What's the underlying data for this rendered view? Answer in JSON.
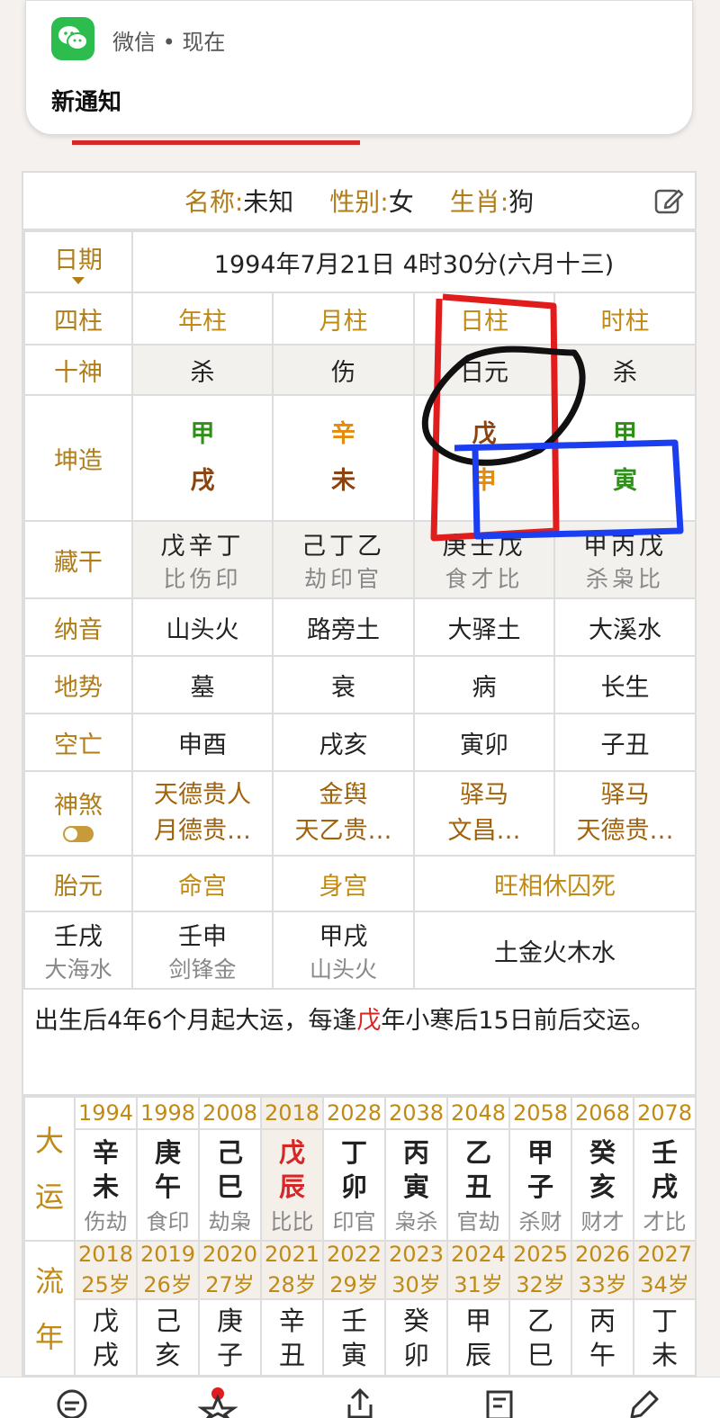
{
  "notification": {
    "app": "微信 • 现在",
    "message": "新通知"
  },
  "header": {
    "name_label": "名称:",
    "name_value": "未知",
    "gender_label": "性别:",
    "gender_value": "女",
    "zodiac_label": "生肖:",
    "zodiac_value": "狗"
  },
  "date": {
    "label": "日期",
    "value": "1994年7月21日 4时30分(六月十三)"
  },
  "pillars": {
    "label": "四柱",
    "headers": [
      "年柱",
      "月柱",
      "日柱",
      "时柱"
    ]
  },
  "shishen": {
    "label": "十神",
    "values": [
      "杀",
      "伤",
      "日元",
      "杀"
    ]
  },
  "kunzao": {
    "label": "坤造",
    "stems": [
      "甲",
      "辛",
      "戊",
      "甲"
    ],
    "branches": [
      "戌",
      "未",
      "申",
      "寅"
    ]
  },
  "canggan": {
    "label": "藏干",
    "stems": [
      "戊辛丁",
      "己丁乙",
      "庚壬戊",
      "甲丙戊"
    ],
    "gods": [
      "比伤印",
      "劫印官",
      "食才比",
      "杀枭比"
    ]
  },
  "nayin": {
    "label": "纳音",
    "values": [
      "山头火",
      "路旁土",
      "大驿土",
      "大溪水"
    ]
  },
  "dishi": {
    "label": "地势",
    "values": [
      "墓",
      "衰",
      "病",
      "长生"
    ]
  },
  "kongwang": {
    "label": "空亡",
    "values": [
      "申酉",
      "戌亥",
      "寅卯",
      "子丑"
    ]
  },
  "shensha": {
    "label": "神煞",
    "line1": [
      "天德贵人",
      "金舆",
      "驿马",
      "驿马"
    ],
    "line2": [
      "月德贵…",
      "天乙贵…",
      "文昌…",
      "天德贵…"
    ]
  },
  "taiyuan_row": {
    "label": "胎元",
    "minggong": "命宫",
    "shengong": "身宫",
    "wangxiang": "旺相休囚死"
  },
  "taiyuan_vals": {
    "taiyuan": "壬戌",
    "taiyuan_sub": "大海水",
    "minggong": "壬申",
    "minggong_sub": "剑锋金",
    "shengong": "甲戌",
    "shengong_sub": "山头火",
    "wangxiang": "土金火木水"
  },
  "note": {
    "before": "出生后4年6个月起大运，每逢",
    "red": "戊",
    "after": "年小寒后15日前后交运。"
  },
  "dayun": {
    "label_1": "大",
    "label_2": "运",
    "years": [
      "1994",
      "1998",
      "2008",
      "2018",
      "2028",
      "2038",
      "2048",
      "2058",
      "2068",
      "2078"
    ],
    "stems": [
      "辛",
      "庚",
      "己",
      "戊",
      "丁",
      "丙",
      "乙",
      "甲",
      "癸",
      "壬"
    ],
    "branches": [
      "未",
      "午",
      "巳",
      "辰",
      "卯",
      "寅",
      "丑",
      "子",
      "亥",
      "戌"
    ],
    "gods": [
      "伤劫",
      "食印",
      "劫枭",
      "比比",
      "印官",
      "枭杀",
      "官劫",
      "杀财",
      "财才",
      "才比"
    ]
  },
  "liunian": {
    "label_1": "流",
    "label_2": "年",
    "years": [
      "2018",
      "2019",
      "2020",
      "2021",
      "2022",
      "2023",
      "2024",
      "2025",
      "2026",
      "2027"
    ],
    "ages": [
      "25岁",
      "26岁",
      "27岁",
      "28岁",
      "29岁",
      "30岁",
      "31岁",
      "32岁",
      "33岁",
      "34岁"
    ],
    "stems": [
      "戊",
      "己",
      "庚",
      "辛",
      "壬",
      "癸",
      "甲",
      "乙",
      "丙",
      "丁"
    ],
    "branches": [
      "戌",
      "亥",
      "子",
      "丑",
      "寅",
      "卯",
      "辰",
      "巳",
      "午",
      "未"
    ]
  },
  "colors": {
    "label_gold": "#b07d18",
    "stem_green": "#2f8f18",
    "stem_orange": "#e58b0c",
    "branch_brown": "#8b4410",
    "highlight_red": "#d62626",
    "annotation_blue": "#1a3ef0",
    "annotation_black": "#111111"
  }
}
